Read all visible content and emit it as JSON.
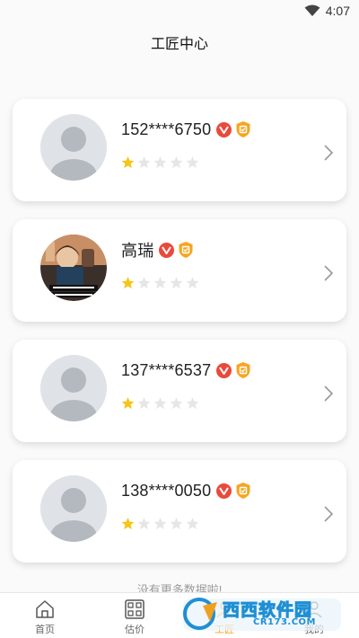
{
  "status_bar": {
    "time": "4:07"
  },
  "header": {
    "title": "工匠中心"
  },
  "craftsmen": [
    {
      "name": "152****6750",
      "rating": 1,
      "max_rating": 5,
      "avatar": "default",
      "verified": true,
      "certified": true
    },
    {
      "name": "高瑞",
      "rating": 1,
      "max_rating": 5,
      "avatar": "photo",
      "verified": true,
      "certified": true
    },
    {
      "name": "137****6537",
      "rating": 1,
      "max_rating": 5,
      "avatar": "default",
      "verified": true,
      "certified": true
    },
    {
      "name": "138****0050",
      "rating": 1,
      "max_rating": 5,
      "avatar": "default",
      "verified": true,
      "certified": true
    }
  ],
  "footer": {
    "no_more": "没有更多数据啦!"
  },
  "tabbar": {
    "items": [
      {
        "label": "首页",
        "icon": "home-icon"
      },
      {
        "label": "估价",
        "icon": "grid-icon"
      },
      {
        "label": "工匠",
        "icon": "craftsman-icon",
        "active": true
      },
      {
        "label": "我的",
        "icon": "user-icon"
      }
    ]
  },
  "watermark": {
    "text": "西西软件园",
    "sub": "CR173.COM"
  },
  "colors": {
    "accent": "#ff9f1c",
    "star_filled": "#f5c518",
    "star_empty": "#e6e6e6",
    "verified_badge": "#e84a3b",
    "certified_badge": "#f5a623"
  }
}
